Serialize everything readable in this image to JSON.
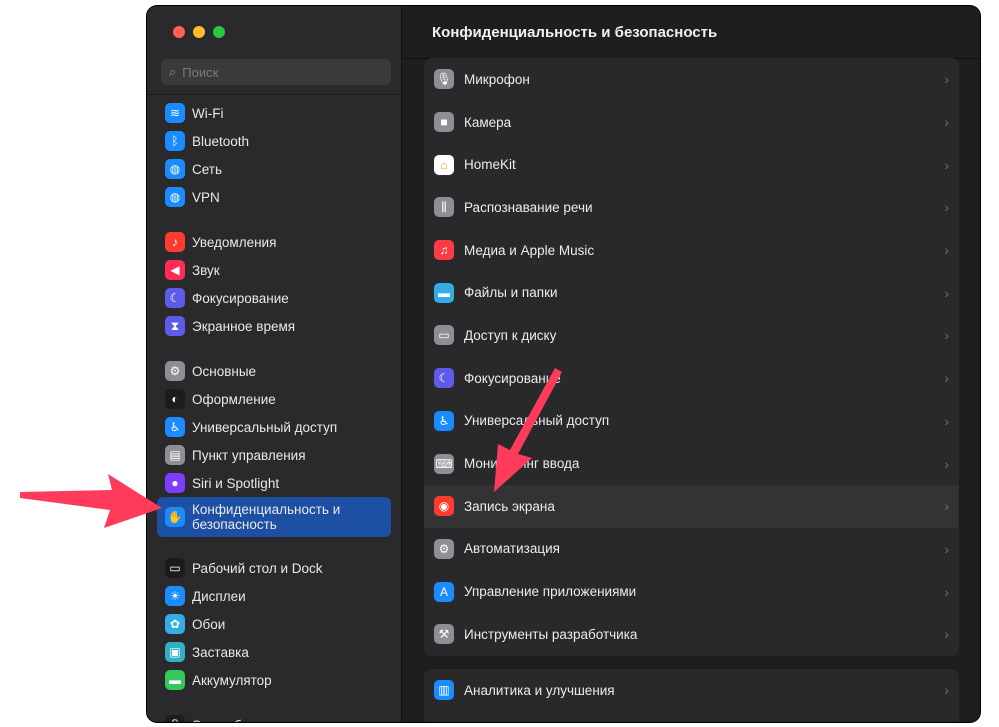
{
  "window": {
    "title": "Конфиденциальность и безопасность",
    "traffic_colors": [
      "#ff5f57",
      "#febc2e",
      "#28c840"
    ]
  },
  "search": {
    "placeholder": "Поиск",
    "icon": "magnifier-icon"
  },
  "sidebar": {
    "groups": [
      [
        {
          "label": "Wi-Fi",
          "icon": "wifi-icon",
          "color": "#1a8cff",
          "glyph": "≋"
        },
        {
          "label": "Bluetooth",
          "icon": "bluetooth-icon",
          "color": "#1a8cff",
          "glyph": "ᛒ"
        },
        {
          "label": "Сеть",
          "icon": "globe-icon",
          "color": "#1a8cff",
          "glyph": "◍"
        },
        {
          "label": "VPN",
          "icon": "globe-icon",
          "color": "#1a8cff",
          "glyph": "◍"
        }
      ],
      [
        {
          "label": "Уведомления",
          "icon": "bell-icon",
          "color": "#ff3b30",
          "glyph": "♪"
        },
        {
          "label": "Звук",
          "icon": "speaker-icon",
          "color": "#ff2d55",
          "glyph": "◀"
        },
        {
          "label": "Фокусирование",
          "icon": "moon-icon",
          "color": "#5e5ce6",
          "glyph": "☾"
        },
        {
          "label": "Экранное время",
          "icon": "hourglass-icon",
          "color": "#5e5ce6",
          "glyph": "⧗"
        }
      ],
      [
        {
          "label": "Основные",
          "icon": "gear-icon",
          "color": "#8e8e93",
          "glyph": "⚙"
        },
        {
          "label": "Оформление",
          "icon": "appearance-icon",
          "color": "#1c1c1e",
          "glyph": "◐"
        },
        {
          "label": "Универсальный доступ",
          "icon": "accessibility-icon",
          "color": "#1a8cff",
          "glyph": "♿"
        },
        {
          "label": "Пункт управления",
          "icon": "control-center-icon",
          "color": "#8e8e93",
          "glyph": "▤"
        },
        {
          "label": "Siri и Spotlight",
          "icon": "siri-icon",
          "color": "#7d3cff",
          "glyph": "●"
        },
        {
          "label": "Конфиденциальность и безопасность",
          "icon": "hand-icon",
          "color": "#1a8cff",
          "glyph": "✋",
          "active": true
        }
      ],
      [
        {
          "label": "Рабочий стол и Dock",
          "icon": "dock-icon",
          "color": "#1c1c1e",
          "glyph": "▭"
        },
        {
          "label": "Дисплеи",
          "icon": "sun-icon",
          "color": "#1a8cff",
          "glyph": "☀"
        },
        {
          "label": "Обои",
          "icon": "flower-icon",
          "color": "#32ade6",
          "glyph": "✿"
        },
        {
          "label": "Заставка",
          "icon": "screensaver-icon",
          "color": "#30b0c7",
          "glyph": "▣"
        },
        {
          "label": "Аккумулятор",
          "icon": "battery-icon",
          "color": "#34c759",
          "glyph": "▬"
        }
      ],
      [
        {
          "label": "Экран блокировки",
          "icon": "lock-icon",
          "color": "#1c1c1e",
          "glyph": "🔒"
        }
      ]
    ]
  },
  "main": {
    "rows": [
      {
        "label": "Микрофон",
        "icon": "microphone-icon",
        "color": "#8e8e93",
        "glyph": "🎙"
      },
      {
        "label": "Камера",
        "icon": "camera-icon",
        "color": "#8e8e93",
        "glyph": "■"
      },
      {
        "label": "HomeKit",
        "icon": "home-icon",
        "color": "#ffffff",
        "glyph": "⌂"
      },
      {
        "label": "Распознавание речи",
        "icon": "waveform-icon",
        "color": "#8e8e93",
        "glyph": "⫼"
      },
      {
        "label": "Медиа и Apple Music",
        "icon": "music-icon",
        "color": "#fc3c44",
        "glyph": "♫"
      },
      {
        "label": "Файлы и папки",
        "icon": "folder-icon",
        "color": "#32ade6",
        "glyph": "▬"
      },
      {
        "label": "Доступ к диску",
        "icon": "disk-icon",
        "color": "#8e8e93",
        "glyph": "▭"
      },
      {
        "label": "Фокусирование",
        "icon": "moon-icon",
        "color": "#5e5ce6",
        "glyph": "☾"
      },
      {
        "label": "Универсальный доступ",
        "icon": "accessibility-icon",
        "color": "#1a8cff",
        "glyph": "♿"
      },
      {
        "label": "Мониторинг ввода",
        "icon": "keyboard-icon",
        "color": "#8e8e93",
        "glyph": "⌨"
      },
      {
        "label": "Запись экрана",
        "icon": "record-icon",
        "color": "#ff3b30",
        "glyph": "◉",
        "highlight": true
      },
      {
        "label": "Автоматизация",
        "icon": "gears-icon",
        "color": "#8e8e93",
        "glyph": "⚙"
      },
      {
        "label": "Управление приложениями",
        "icon": "app-store-icon",
        "color": "#1a8cff",
        "glyph": "A"
      },
      {
        "label": "Инструменты разработчика",
        "icon": "hammer-icon",
        "color": "#8e8e93",
        "glyph": "⚒"
      }
    ],
    "rows2": [
      {
        "label": "Аналитика и улучшения",
        "icon": "chart-icon",
        "color": "#1a8cff",
        "glyph": "▥"
      }
    ]
  },
  "annotation_color": "#ff3b5c"
}
